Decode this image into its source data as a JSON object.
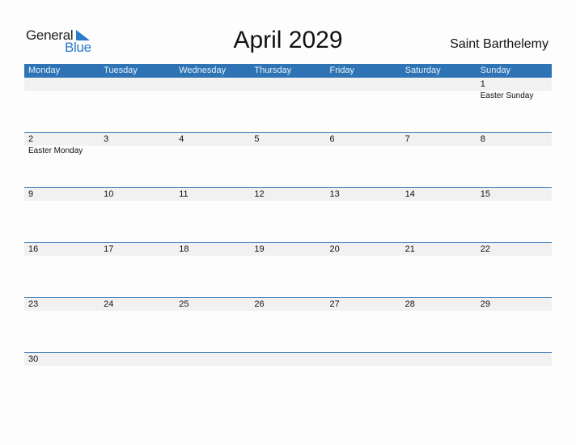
{
  "logo": {
    "word1": "General",
    "word2": "Blue",
    "accent": "#2a7bc8"
  },
  "title": "April 2029",
  "country": "Saint Barthelemy",
  "colors": {
    "header_bg": "#2e74b5",
    "band_bg": "#f1f1f1"
  },
  "weekdays": [
    "Monday",
    "Tuesday",
    "Wednesday",
    "Thursday",
    "Friday",
    "Saturday",
    "Sunday"
  ],
  "weeks": [
    [
      {
        "day": "",
        "event": ""
      },
      {
        "day": "",
        "event": ""
      },
      {
        "day": "",
        "event": ""
      },
      {
        "day": "",
        "event": ""
      },
      {
        "day": "",
        "event": ""
      },
      {
        "day": "",
        "event": ""
      },
      {
        "day": "1",
        "event": "Easter Sunday"
      }
    ],
    [
      {
        "day": "2",
        "event": "Easter Monday"
      },
      {
        "day": "3",
        "event": ""
      },
      {
        "day": "4",
        "event": ""
      },
      {
        "day": "5",
        "event": ""
      },
      {
        "day": "6",
        "event": ""
      },
      {
        "day": "7",
        "event": ""
      },
      {
        "day": "8",
        "event": ""
      }
    ],
    [
      {
        "day": "9",
        "event": ""
      },
      {
        "day": "10",
        "event": ""
      },
      {
        "day": "11",
        "event": ""
      },
      {
        "day": "12",
        "event": ""
      },
      {
        "day": "13",
        "event": ""
      },
      {
        "day": "14",
        "event": ""
      },
      {
        "day": "15",
        "event": ""
      }
    ],
    [
      {
        "day": "16",
        "event": ""
      },
      {
        "day": "17",
        "event": ""
      },
      {
        "day": "18",
        "event": ""
      },
      {
        "day": "19",
        "event": ""
      },
      {
        "day": "20",
        "event": ""
      },
      {
        "day": "21",
        "event": ""
      },
      {
        "day": "22",
        "event": ""
      }
    ],
    [
      {
        "day": "23",
        "event": ""
      },
      {
        "day": "24",
        "event": ""
      },
      {
        "day": "25",
        "event": ""
      },
      {
        "day": "26",
        "event": ""
      },
      {
        "day": "27",
        "event": ""
      },
      {
        "day": "28",
        "event": ""
      },
      {
        "day": "29",
        "event": ""
      }
    ],
    [
      {
        "day": "30",
        "event": ""
      },
      {
        "day": "",
        "event": ""
      },
      {
        "day": "",
        "event": ""
      },
      {
        "day": "",
        "event": ""
      },
      {
        "day": "",
        "event": ""
      },
      {
        "day": "",
        "event": ""
      },
      {
        "day": "",
        "event": ""
      }
    ]
  ]
}
